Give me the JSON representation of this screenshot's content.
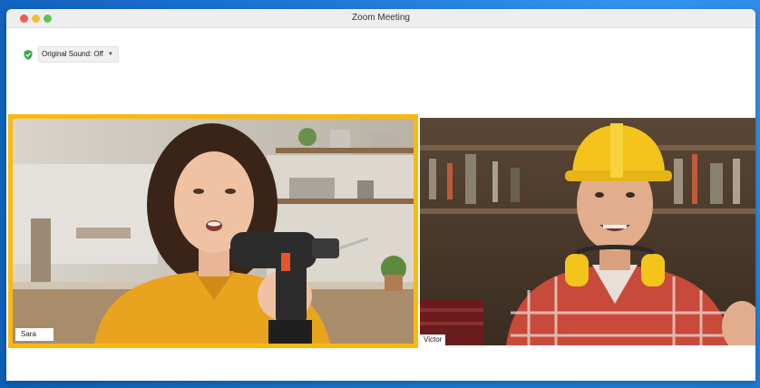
{
  "window": {
    "title": "Zoom Meeting"
  },
  "toolbar": {
    "original_sound_label": "Original Sound: Off",
    "shield_icon": "shield-check-icon",
    "caret_icon": "chevron-down-icon"
  },
  "participants": [
    {
      "name": "Sara",
      "active_speaker": true
    },
    {
      "name": "Victor",
      "active_speaker": false
    }
  ],
  "colors": {
    "active_speaker_border": "#fbb80f",
    "shield": "#3ea94a",
    "background": "#1f7ad6"
  }
}
